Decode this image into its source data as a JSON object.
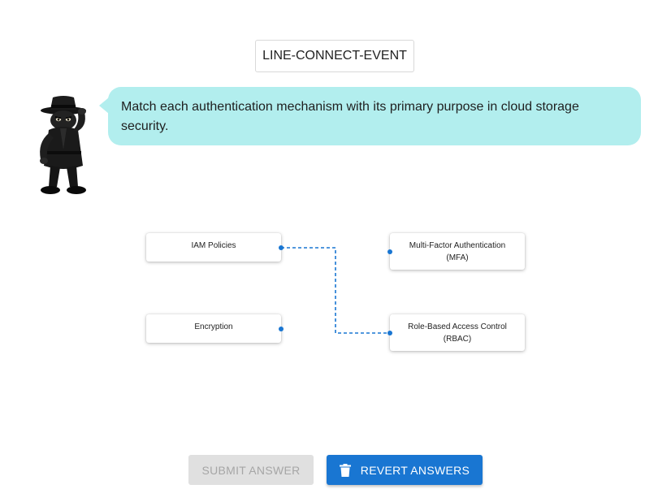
{
  "event_tag": "LINE-CONNECT-EVENT",
  "prompt": {
    "text": "Match each authentication mechanism with its primary purpose in cloud storage security."
  },
  "left_items": [
    {
      "label": "IAM Policies"
    },
    {
      "label": "Encryption"
    }
  ],
  "right_items": [
    {
      "label_line1": "Multi-Factor Authentication",
      "label_line2": "(MFA)"
    },
    {
      "label_line1": "Role-Based Access Control",
      "label_line2": "(RBAC)"
    }
  ],
  "connections": [
    {
      "from": "IAM Policies",
      "to": "Role-Based Access Control (RBAC)"
    }
  ],
  "buttons": {
    "submit_label": "SUBMIT ANSWER",
    "submit_enabled": false,
    "revert_label": "REVERT ANSWERS",
    "revert_icon": "trash-icon"
  },
  "colors": {
    "accent": "#1976d2",
    "bubble": "#b2eeee",
    "disabled_bg": "#e0e0e0",
    "disabled_text": "#a6a6a6"
  }
}
